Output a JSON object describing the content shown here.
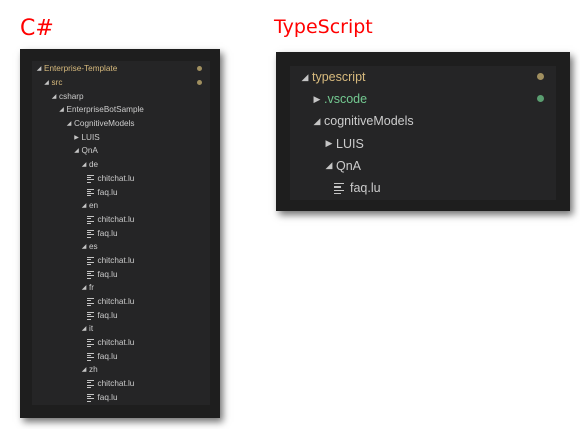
{
  "headings": {
    "csharp": "C#",
    "typescript": "TypeScript"
  },
  "colors": {
    "heading": "#ff0000",
    "git_modified_text": "#d7ba7d",
    "git_modified_dot": "#a08f5f",
    "untracked_text": "#73c991",
    "untracked_dot": "#5a9e70",
    "panel_background": "#252526"
  },
  "csharp_tree": [
    {
      "label": "Enterprise-Template",
      "depth": 0,
      "kind": "folder",
      "expanded": true,
      "status": "git",
      "dot": true
    },
    {
      "label": "src",
      "depth": 1,
      "kind": "folder",
      "expanded": true,
      "status": "git",
      "dot": true
    },
    {
      "label": "csharp",
      "depth": 2,
      "kind": "folder",
      "expanded": true
    },
    {
      "label": "EnterpriseBotSample",
      "depth": 3,
      "kind": "folder",
      "expanded": true
    },
    {
      "label": "CognitiveModels",
      "depth": 4,
      "kind": "folder",
      "expanded": true
    },
    {
      "label": "LUIS",
      "depth": 5,
      "kind": "folder",
      "expanded": false
    },
    {
      "label": "QnA",
      "depth": 5,
      "kind": "folder",
      "expanded": true
    },
    {
      "label": "de",
      "depth": 6,
      "kind": "folder",
      "expanded": true
    },
    {
      "label": "chitchat.lu",
      "depth": 7,
      "kind": "file"
    },
    {
      "label": "faq.lu",
      "depth": 7,
      "kind": "file"
    },
    {
      "label": "en",
      "depth": 6,
      "kind": "folder",
      "expanded": true
    },
    {
      "label": "chitchat.lu",
      "depth": 7,
      "kind": "file"
    },
    {
      "label": "faq.lu",
      "depth": 7,
      "kind": "file"
    },
    {
      "label": "es",
      "depth": 6,
      "kind": "folder",
      "expanded": true
    },
    {
      "label": "chitchat.lu",
      "depth": 7,
      "kind": "file"
    },
    {
      "label": "faq.lu",
      "depth": 7,
      "kind": "file"
    },
    {
      "label": "fr",
      "depth": 6,
      "kind": "folder",
      "expanded": true
    },
    {
      "label": "chitchat.lu",
      "depth": 7,
      "kind": "file"
    },
    {
      "label": "faq.lu",
      "depth": 7,
      "kind": "file"
    },
    {
      "label": "it",
      "depth": 6,
      "kind": "folder",
      "expanded": true
    },
    {
      "label": "chitchat.lu",
      "depth": 7,
      "kind": "file"
    },
    {
      "label": "faq.lu",
      "depth": 7,
      "kind": "file"
    },
    {
      "label": "zh",
      "depth": 6,
      "kind": "folder",
      "expanded": true
    },
    {
      "label": "chitchat.lu",
      "depth": 7,
      "kind": "file"
    },
    {
      "label": "faq.lu",
      "depth": 7,
      "kind": "file"
    }
  ],
  "typescript_tree": [
    {
      "label": "typescript",
      "depth": 0,
      "kind": "folder",
      "expanded": true,
      "status": "git",
      "dot": true
    },
    {
      "label": ".vscode",
      "depth": 1,
      "kind": "folder",
      "expanded": false,
      "status": "untracked",
      "dot": true
    },
    {
      "label": "cognitiveModels",
      "depth": 1,
      "kind": "folder",
      "expanded": true
    },
    {
      "label": "LUIS",
      "depth": 2,
      "kind": "folder",
      "expanded": false
    },
    {
      "label": "QnA",
      "depth": 2,
      "kind": "folder",
      "expanded": true
    },
    {
      "label": "faq.lu",
      "depth": 3,
      "kind": "file"
    }
  ]
}
